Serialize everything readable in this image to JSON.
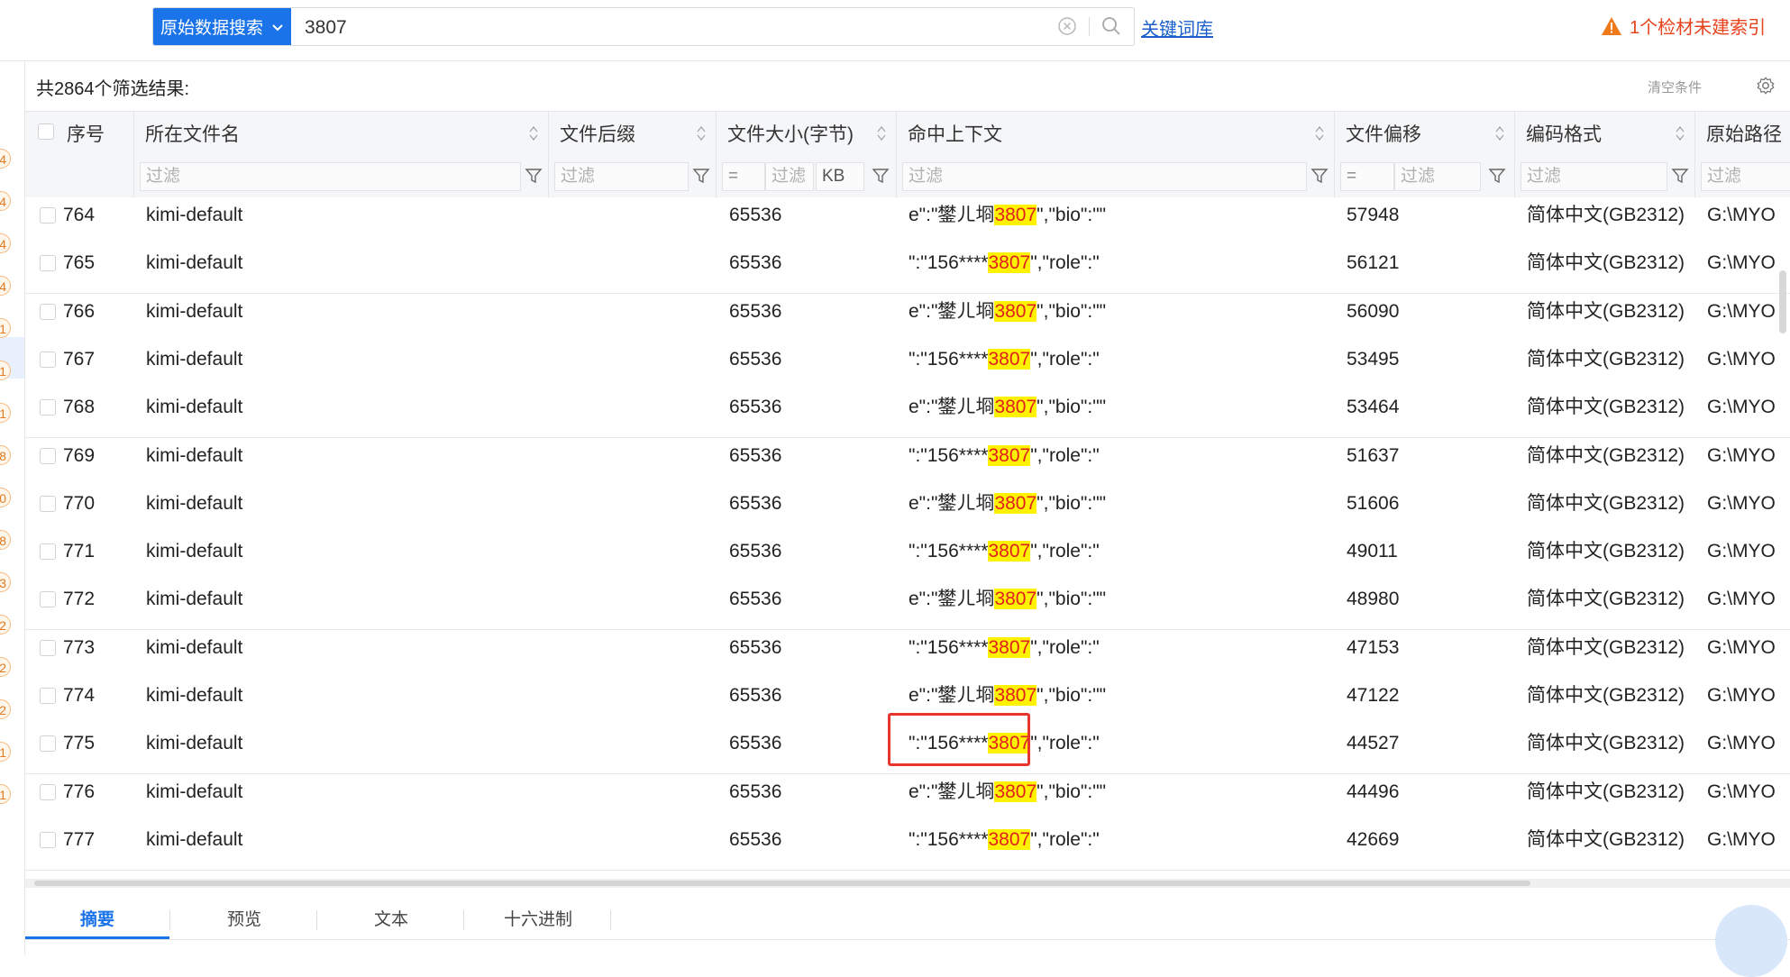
{
  "search": {
    "scope_label": "原始数据搜索",
    "query": "3807",
    "keyword_link": "关键词库"
  },
  "warning": {
    "text": "1个检材未建索引",
    "color": "#e8421c"
  },
  "sidebar_badges": [
    "4",
    "4",
    "4",
    "4",
    "1",
    "1",
    "1",
    "8",
    "0",
    "8",
    "3",
    "2",
    "2",
    "2",
    "1",
    "1"
  ],
  "results": {
    "count_text": "共2864个筛选结果:",
    "clear_conditions": "清空条件"
  },
  "columns": [
    {
      "label": "序号"
    },
    {
      "label": "所在文件名",
      "filter": "过滤"
    },
    {
      "label": "文件后缀",
      "filter": "过滤"
    },
    {
      "label": "文件大小(字节)",
      "filter_op": "=",
      "filter": "过滤",
      "unit": "KB"
    },
    {
      "label": "命中上下文",
      "filter": "过滤"
    },
    {
      "label": "文件偏移",
      "filter_op": "=",
      "filter": "过滤"
    },
    {
      "label": "编码格式",
      "filter": "过滤"
    },
    {
      "label": "原始路径",
      "filter": "过滤"
    }
  ],
  "rows": [
    {
      "seq": "764",
      "file": "kimi-default",
      "suffix": "",
      "size": "65536",
      "ctx_pre": "e\":\"鐢ㄦ埛",
      "ctx_hit": "3807",
      "ctx_post": "\",\"bio\":\"\"",
      "offset": "57948",
      "enc": "简体中文(GB2312)",
      "path": "G:\\MYO"
    },
    {
      "seq": "765",
      "file": "kimi-default",
      "suffix": "",
      "size": "65536",
      "ctx_pre": "\":\"156****",
      "ctx_hit": "3807",
      "ctx_post": "\",\"role\":\"",
      "offset": "56121",
      "enc": "简体中文(GB2312)",
      "path": "G:\\MYO"
    },
    {
      "seq": "766",
      "file": "kimi-default",
      "suffix": "",
      "size": "65536",
      "ctx_pre": "e\":\"鐢ㄦ埛",
      "ctx_hit": "3807",
      "ctx_post": "\",\"bio\":\"\"",
      "offset": "56090",
      "enc": "简体中文(GB2312)",
      "path": "G:\\MYO"
    },
    {
      "seq": "767",
      "file": "kimi-default",
      "suffix": "",
      "size": "65536",
      "ctx_pre": "\":\"156****",
      "ctx_hit": "3807",
      "ctx_post": "\",\"role\":\"",
      "offset": "53495",
      "enc": "简体中文(GB2312)",
      "path": "G:\\MYO"
    },
    {
      "seq": "768",
      "file": "kimi-default",
      "suffix": "",
      "size": "65536",
      "ctx_pre": "e\":\"鐢ㄦ埛",
      "ctx_hit": "3807",
      "ctx_post": "\",\"bio\":\"\"",
      "offset": "53464",
      "enc": "简体中文(GB2312)",
      "path": "G:\\MYO"
    },
    {
      "seq": "769",
      "file": "kimi-default",
      "suffix": "",
      "size": "65536",
      "ctx_pre": "\":\"156****",
      "ctx_hit": "3807",
      "ctx_post": "\",\"role\":\"",
      "offset": "51637",
      "enc": "简体中文(GB2312)",
      "path": "G:\\MYO"
    },
    {
      "seq": "770",
      "file": "kimi-default",
      "suffix": "",
      "size": "65536",
      "ctx_pre": "e\":\"鐢ㄦ埛",
      "ctx_hit": "3807",
      "ctx_post": "\",\"bio\":\"\"",
      "offset": "51606",
      "enc": "简体中文(GB2312)",
      "path": "G:\\MYO"
    },
    {
      "seq": "771",
      "file": "kimi-default",
      "suffix": "",
      "size": "65536",
      "ctx_pre": "\":\"156****",
      "ctx_hit": "3807",
      "ctx_post": "\",\"role\":\"",
      "offset": "49011",
      "enc": "简体中文(GB2312)",
      "path": "G:\\MYO"
    },
    {
      "seq": "772",
      "file": "kimi-default",
      "suffix": "",
      "size": "65536",
      "ctx_pre": "e\":\"鐢ㄦ埛",
      "ctx_hit": "3807",
      "ctx_post": "\",\"bio\":\"\"",
      "offset": "48980",
      "enc": "简体中文(GB2312)",
      "path": "G:\\MYO"
    },
    {
      "seq": "773",
      "file": "kimi-default",
      "suffix": "",
      "size": "65536",
      "ctx_pre": "\":\"156****",
      "ctx_hit": "3807",
      "ctx_post": "\",\"role\":\"",
      "offset": "47153",
      "enc": "简体中文(GB2312)",
      "path": "G:\\MYO"
    },
    {
      "seq": "774",
      "file": "kimi-default",
      "suffix": "",
      "size": "65536",
      "ctx_pre": "e\":\"鐢ㄦ埛",
      "ctx_hit": "3807",
      "ctx_post": "\",\"bio\":\"\"",
      "offset": "47122",
      "enc": "简体中文(GB2312)",
      "path": "G:\\MYO"
    },
    {
      "seq": "775",
      "file": "kimi-default",
      "suffix": "",
      "size": "65536",
      "ctx_pre": "\":\"156****",
      "ctx_hit": "3807",
      "ctx_post": "\",\"role\":\"",
      "offset": "44527",
      "enc": "简体中文(GB2312)",
      "path": "G:\\MYO"
    },
    {
      "seq": "776",
      "file": "kimi-default",
      "suffix": "",
      "size": "65536",
      "ctx_pre": "e\":\"鐢ㄦ埛",
      "ctx_hit": "3807",
      "ctx_post": "\",\"bio\":\"\"",
      "offset": "44496",
      "enc": "简体中文(GB2312)",
      "path": "G:\\MYO"
    },
    {
      "seq": "777",
      "file": "kimi-default",
      "suffix": "",
      "size": "65536",
      "ctx_pre": "\":\"156****",
      "ctx_hit": "3807",
      "ctx_post": "\",\"role\":\"",
      "offset": "42669",
      "enc": "简体中文(GB2312)",
      "path": "G:\\MYO"
    }
  ],
  "bottom_tabs": [
    {
      "label": "摘要",
      "active": true
    },
    {
      "label": "预览",
      "active": false
    },
    {
      "label": "文本",
      "active": false
    },
    {
      "label": "十六进制",
      "active": false
    }
  ],
  "colors": {
    "accent": "#1a73e8",
    "highlight_bg": "#fff200",
    "highlight_text": "#e02020",
    "selection_box": "#e8362e"
  }
}
